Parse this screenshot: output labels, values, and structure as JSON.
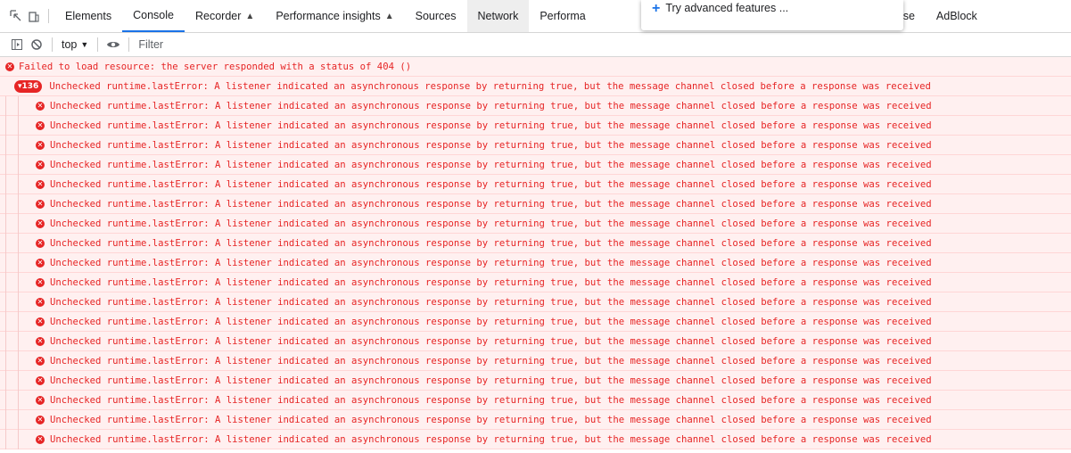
{
  "tabs": [
    {
      "label": "Elements",
      "active": false
    },
    {
      "label": "Console",
      "active": true
    },
    {
      "label": "Recorder",
      "flask": true
    },
    {
      "label": "Performance insights",
      "flask": true
    },
    {
      "label": "Sources"
    },
    {
      "label": "Network"
    },
    {
      "label": "Performa"
    },
    {
      "label": "Lighthouse"
    },
    {
      "label": "AdBlock"
    }
  ],
  "popup": {
    "text": "Try advanced features ...",
    "icon": "plus-icon"
  },
  "toolbar": {
    "context": "top",
    "filter_placeholder": "Filter",
    "icons": [
      "sidebar-toggle-icon",
      "clear-console-icon",
      "eye-icon"
    ]
  },
  "console": {
    "error_404": "Failed to load resource: the server responded with a status of 404 ()",
    "group": {
      "badge": "▾136",
      "text": "Unchecked runtime.lastError: A listener indicated an asynchronous response by returning true, but the message channel closed before a response was received"
    },
    "child_text": "Unchecked runtime.lastError: A listener indicated an asynchronous response by returning true, but the message channel closed before a response was received",
    "visible_child_count": 18
  },
  "colors": {
    "error_text": "#e62525",
    "error_bg": "#fff0f0",
    "active_tab": "#1a73e8"
  }
}
